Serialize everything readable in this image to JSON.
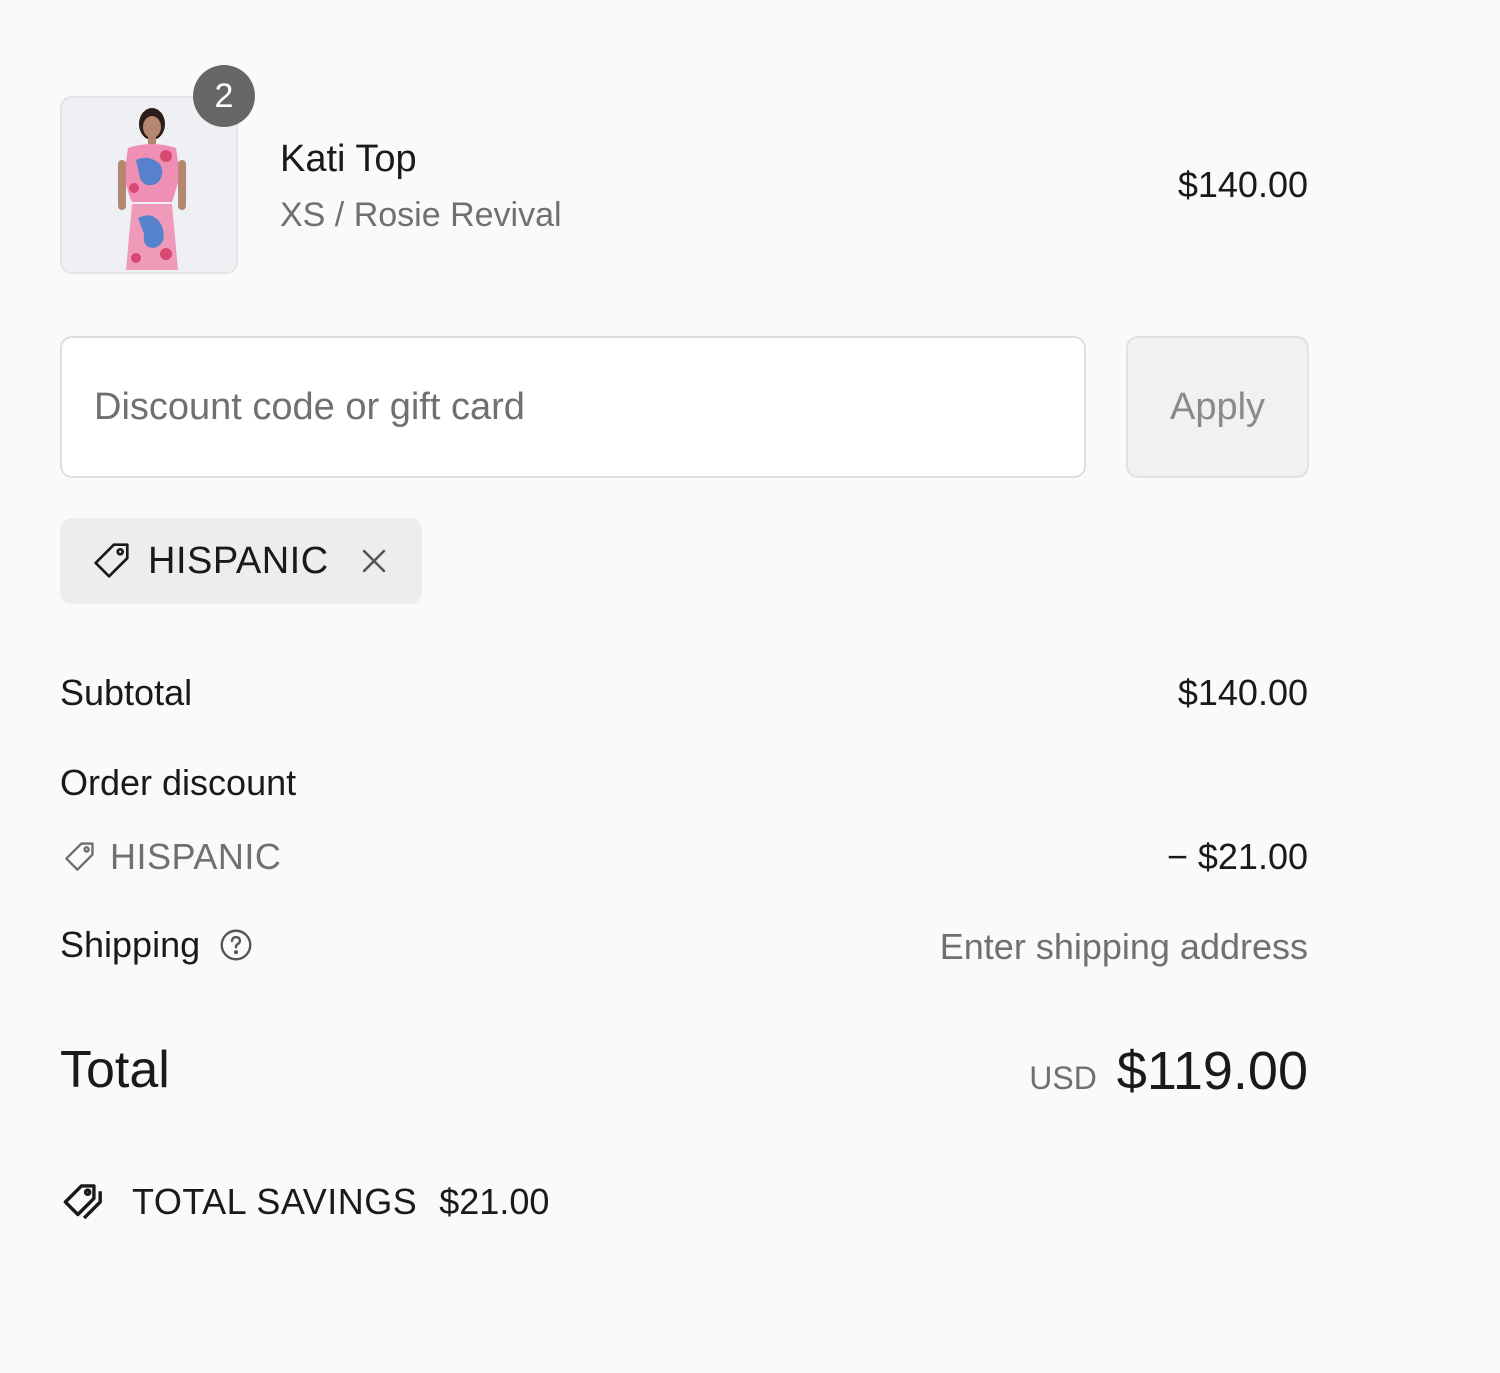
{
  "line_item": {
    "quantity": "2",
    "name": "Kati Top",
    "variant": "XS / Rosie Revival",
    "price": "$140.00"
  },
  "discount": {
    "placeholder": "Discount code or gift card",
    "value": "",
    "apply_label": "Apply",
    "applied_code": "HISPANIC"
  },
  "summary": {
    "subtotal_label": "Subtotal",
    "subtotal_value": "$140.00",
    "order_discount_label": "Order discount",
    "order_discount_code": "HISPANIC",
    "order_discount_value": "− $21.00",
    "shipping_label": "Shipping",
    "shipping_value": "Enter shipping address",
    "total_label": "Total",
    "currency": "USD",
    "total_value": "$119.00",
    "savings_label": "TOTAL SAVINGS",
    "savings_value": "$21.00"
  },
  "icons": {
    "tag": "tag-icon",
    "remove": "close-icon",
    "help": "question-circle-icon",
    "savings": "double-tag-icon"
  },
  "colors": {
    "background": "#fafafa",
    "text": "#1a1a1a",
    "muted": "#707070",
    "badge": "#666666"
  }
}
